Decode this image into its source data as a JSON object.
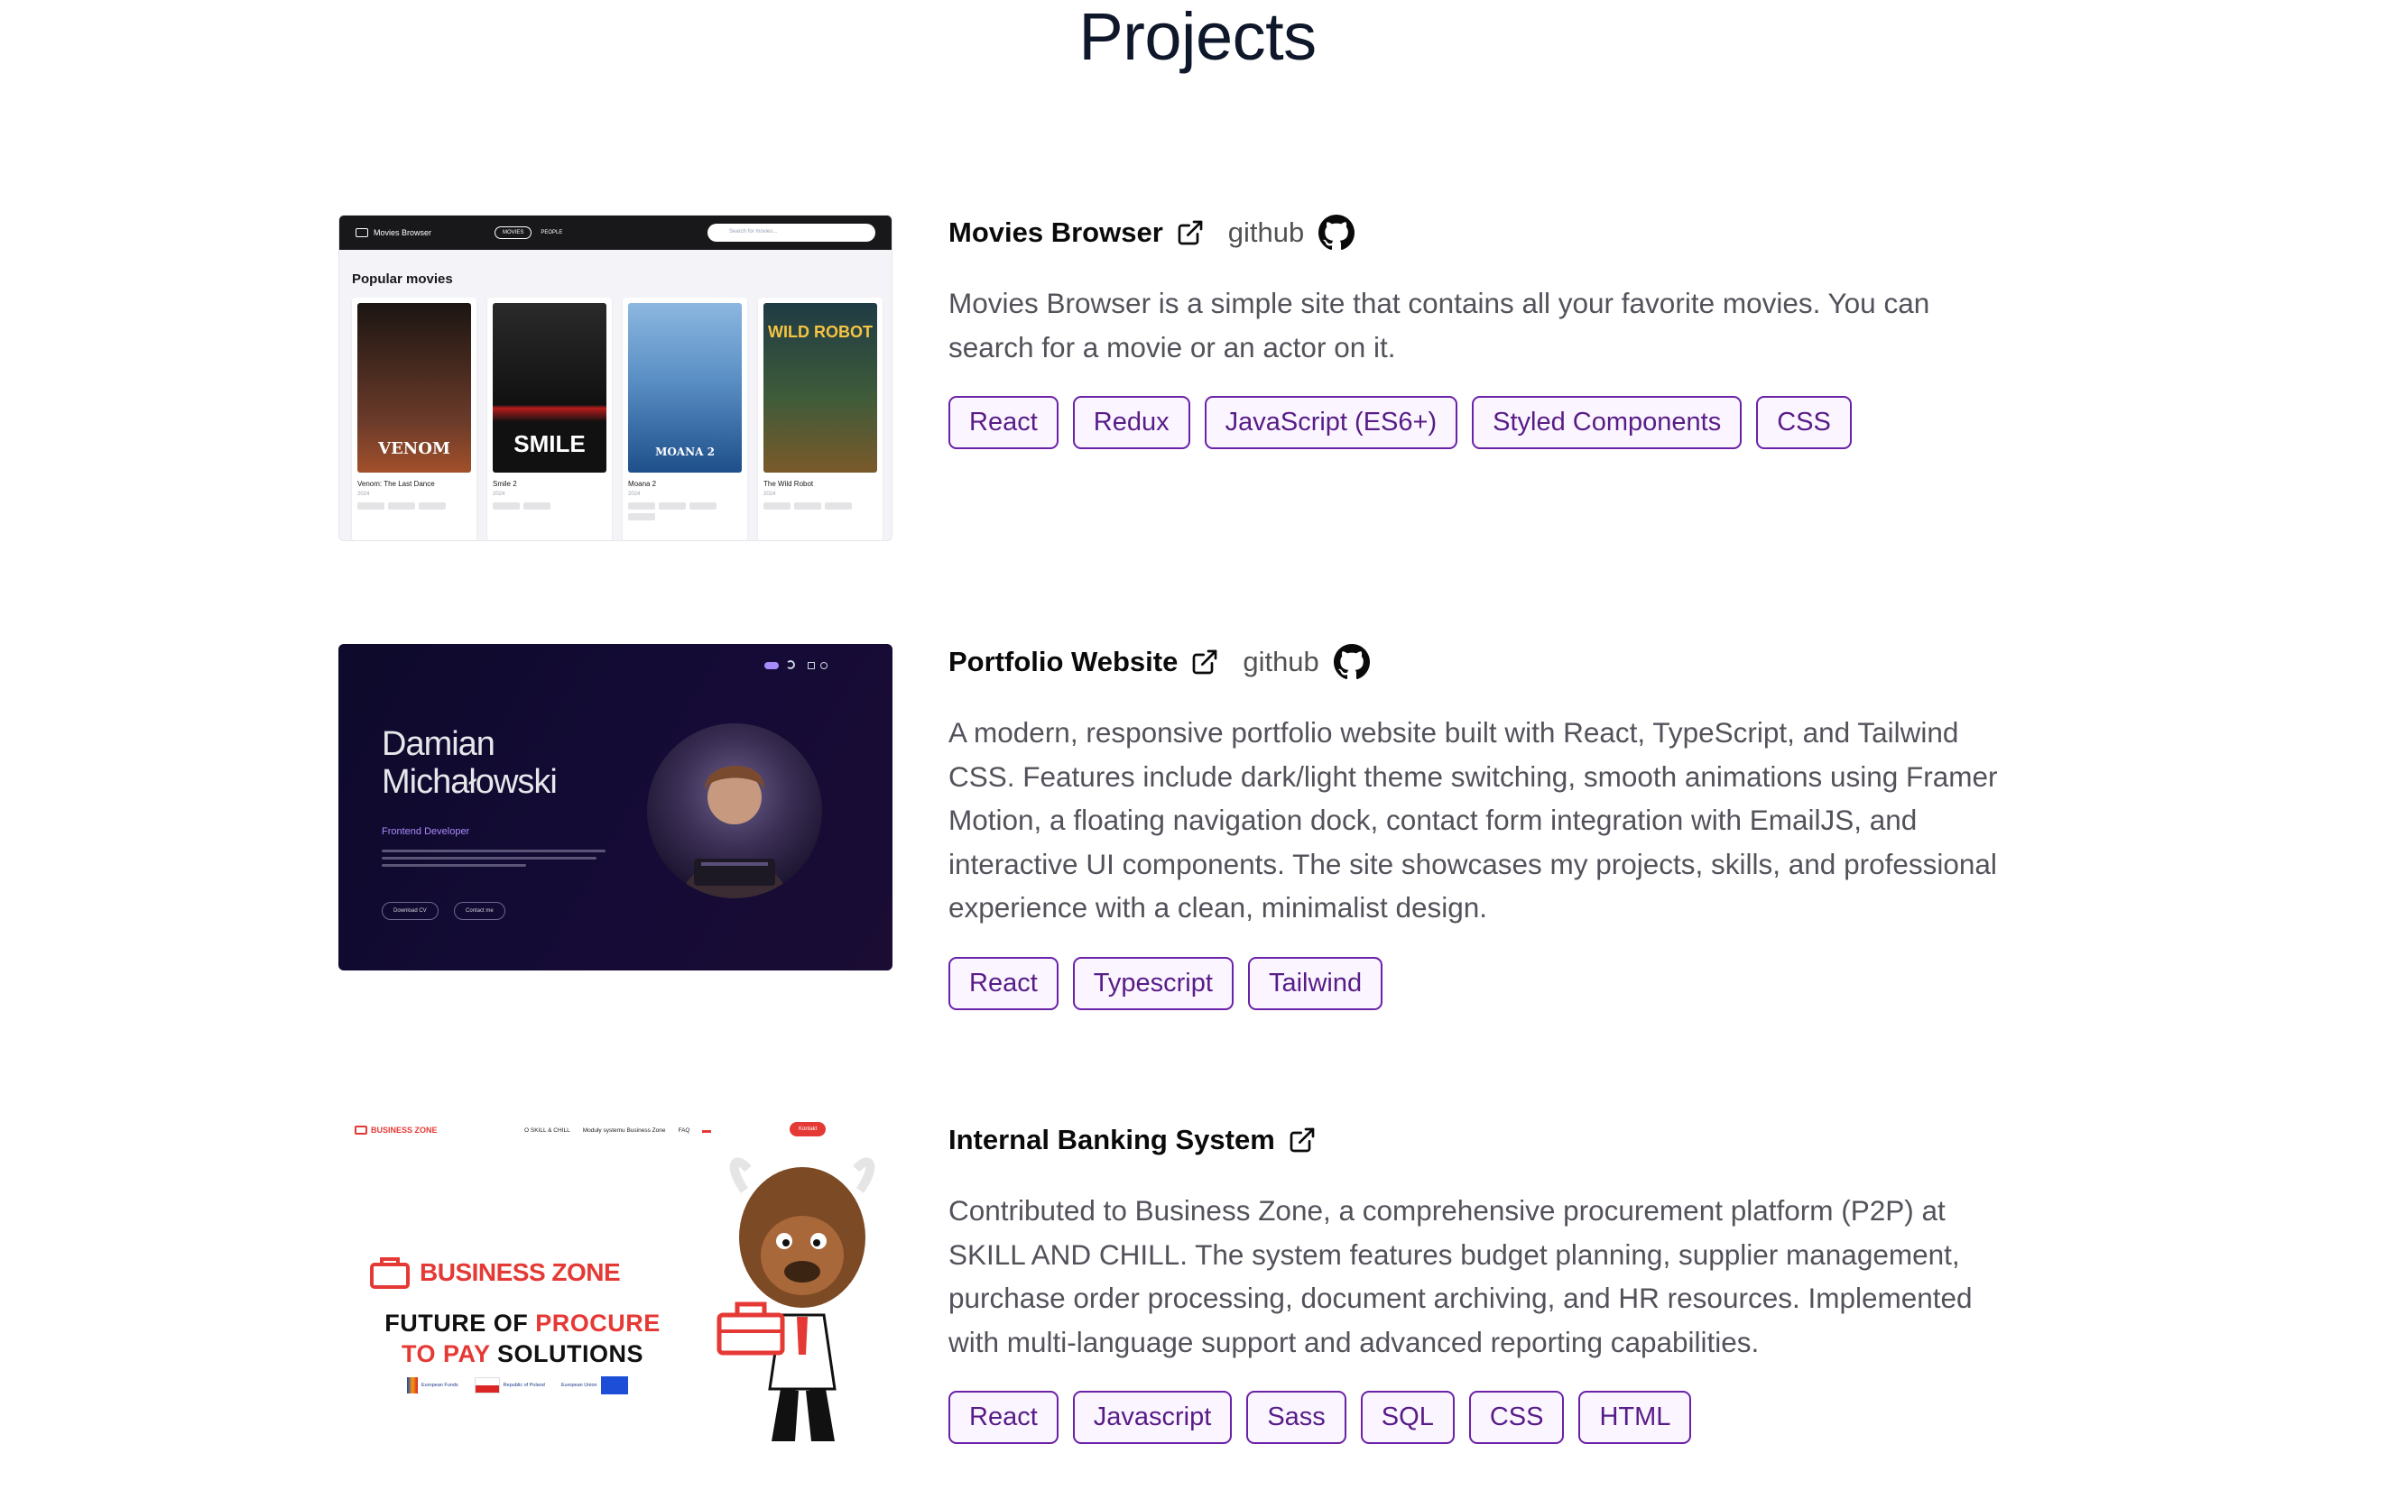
{
  "page": {
    "title": "Projects"
  },
  "projects": [
    {
      "title": "Movies Browser",
      "github_label": "github",
      "description": "Movies Browser is a simple site that contains all your favorite movies. You can search for a movie or an actor on it.",
      "tags": [
        "React",
        "Redux",
        "JavaScript (ES6+)",
        "Styled Components",
        "CSS"
      ],
      "thumb": {
        "app_name": "Movies Browser",
        "nav": [
          "MOVIES",
          "PEOPLE"
        ],
        "search_placeholder": "Search for movies...",
        "heading": "Popular movies",
        "movies": [
          {
            "name": "Venom: The Last Dance",
            "year": "2024",
            "poster_text": "VENOM",
            "color": "#3b2a22"
          },
          {
            "name": "Smile 2",
            "year": "2024",
            "poster_text": "SMILE",
            "color": "#1f1f1f"
          },
          {
            "name": "Moana 2",
            "year": "2024",
            "poster_text": "MOANA 2",
            "color": "#3c6fb0"
          },
          {
            "name": "The Wild Robot",
            "year": "2024",
            "poster_text": "WILD ROBOT",
            "color": "#2e3f2f"
          }
        ]
      }
    },
    {
      "title": "Portfolio Website",
      "github_label": "github",
      "description": "A modern, responsive portfolio website built with React, TypeScript, and Tailwind CSS. Features include dark/light theme switching, smooth animations using Framer Motion, a floating navigation dock, contact form integration with EmailJS, and interactive UI components. The site showcases my projects, skills, and professional experience with a clean, minimalist design.",
      "tags": [
        "React",
        "Typescript",
        "Tailwind"
      ],
      "thumb": {
        "name_line1": "Damian",
        "name_line2": "Michałowski",
        "role": "Frontend Developer",
        "button1": "Download CV",
        "button2": "Contact me"
      }
    },
    {
      "title": "Internal Banking System",
      "description": "Contributed to Business Zone, a comprehensive procurement platform (P2P) at SKILL AND CHILL. The system features budget planning, supplier management, purchase order processing, document archiving, and HR resources. Implemented with multi-language support and advanced reporting capabilities.",
      "tags": [
        "React",
        "Javascript",
        "Sass",
        "SQL",
        "CSS",
        "HTML"
      ],
      "thumb": {
        "logo_small": "BUSINESS ZONE",
        "nav": [
          "O SKILL & CHILL",
          "Moduły systemu Business Zone",
          "FAQ"
        ],
        "cta": "Kontakt",
        "logo_big": "BUSINESS ZONE",
        "slogan_line1_a": "FUTURE OF",
        "slogan_line1_b": "PROCURE",
        "slogan_line2_a": "TO PAY",
        "slogan_line2_b": "SOLUTIONS",
        "eu_funds": "European Funds",
        "poland": "Republic of Poland",
        "eu_union": "European Union"
      }
    }
  ],
  "colors": {
    "tag_border": "#6b21a8",
    "tag_text": "#581c87",
    "brand_red": "#e53935"
  }
}
